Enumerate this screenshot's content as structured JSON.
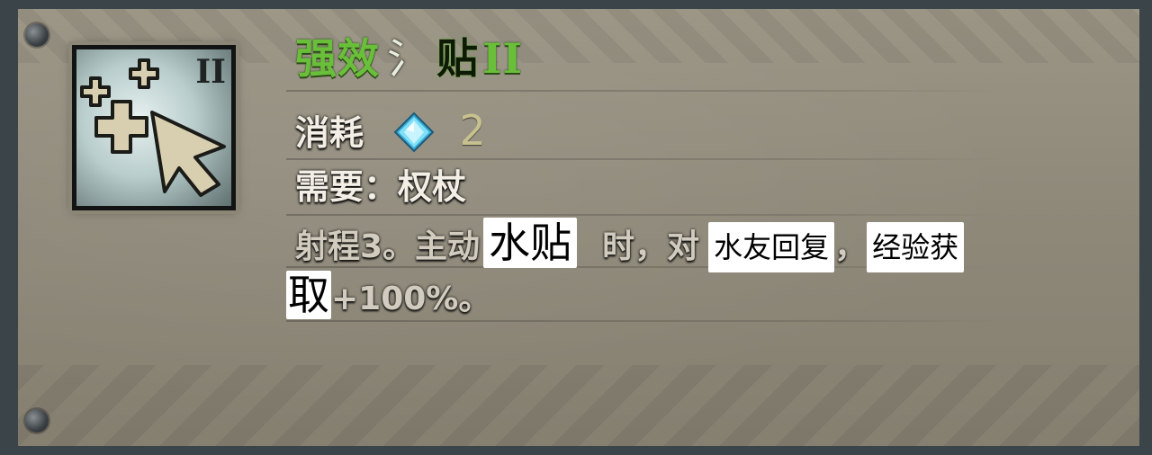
{
  "skill": {
    "tier_badge": "II",
    "title_part1": "强效",
    "title_glyph": "氵",
    "title_part2": "贴",
    "title_tier": "II",
    "cost_label": "消耗",
    "cost_icon": "blue-crystal-icon",
    "cost_value": "2",
    "requirement": "需要：权杖",
    "desc_line1": [
      {
        "text": "射程3。主动",
        "style": "faded"
      },
      {
        "text": "水贴",
        "style": "overlay-big"
      },
      {
        "text": "时，对",
        "style": "faded"
      },
      {
        "text": "水友回复",
        "style": "overlay"
      },
      {
        "text": "，",
        "style": "faded"
      },
      {
        "text": "经验获",
        "style": "overlay"
      }
    ],
    "desc_line2": [
      {
        "text": "取",
        "style": "overlay-big"
      },
      {
        "text": "+100%。",
        "style": "faded"
      }
    ]
  },
  "colors": {
    "title_green": "#6abf3a",
    "panel_parchment": "#8f897a",
    "frame_slate": "#3b4448",
    "crystal_blue": "#5fd0f0"
  }
}
